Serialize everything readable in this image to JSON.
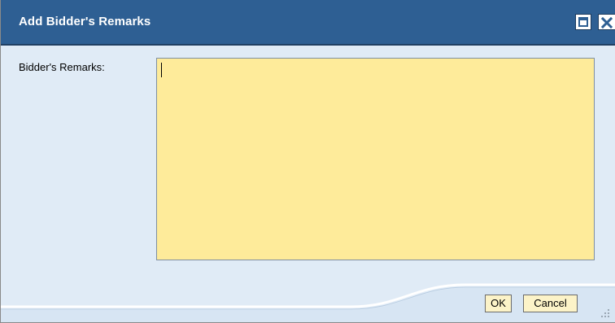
{
  "dialog": {
    "title": "Add Bidder's Remarks",
    "maximize_icon": "maximize-icon",
    "close_icon": "close-icon"
  },
  "form": {
    "remarks_label": "Bidder's Remarks:",
    "remarks_value": ""
  },
  "footer": {
    "ok_label": "OK",
    "cancel_label": "Cancel",
    "resize_icon": "resize-grip-icon"
  },
  "colors": {
    "titlebar": "#2e5f93",
    "body": "#e0ebf6",
    "textarea": "#feeb9a",
    "button": "#fcf3c8"
  }
}
